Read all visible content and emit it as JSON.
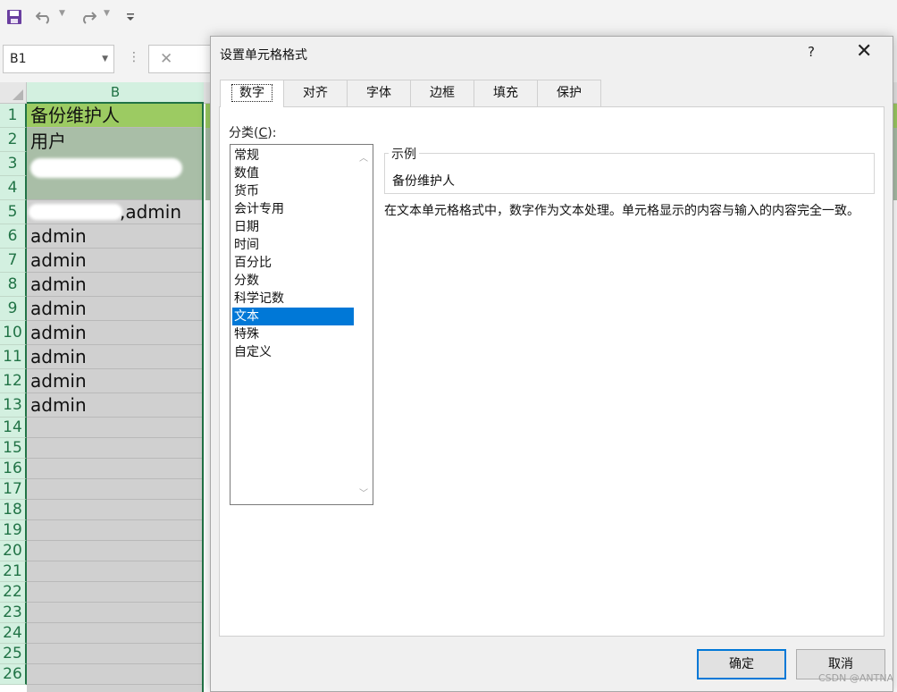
{
  "quick_access": {
    "save_icon": "floppy-save-icon",
    "undo_icon": "undo-arrow-icon",
    "redo_icon": "redo-arrow-icon",
    "customize_icon": "customize-toolbar-icon"
  },
  "formula_bar": {
    "name_box": "B1",
    "cancel_symbol": "✕"
  },
  "sheet": {
    "column_header": "B",
    "row_numbers": [
      "1",
      "2",
      "3",
      "4",
      "5",
      "6",
      "7",
      "8",
      "9",
      "10",
      "11",
      "12",
      "13",
      "14",
      "15",
      "16",
      "17",
      "18",
      "19",
      "20",
      "21",
      "22",
      "23",
      "24",
      "25",
      "26"
    ],
    "cells": {
      "b1": "备份维护人",
      "b2": "用户",
      "b3": "",
      "b5": ",admin",
      "b6": "admin",
      "b7": "admin",
      "b8": "admin",
      "b9": "admin",
      "b10": "admin",
      "b11": "admin",
      "b12": "admin",
      "b13": "admin"
    },
    "colors": {
      "header_green": "#9ccb62",
      "merged_green": "#a9bea7",
      "selection_green": "#217346"
    }
  },
  "dialog": {
    "title": "设置单元格格式",
    "help": "?",
    "close": "✕",
    "tabs": [
      "数字",
      "对齐",
      "字体",
      "边框",
      "填充",
      "保护"
    ],
    "active_tab": "数字",
    "category_label_prefix": "分类(",
    "category_label_key": "C",
    "category_label_suffix": "):",
    "categories": [
      "常规",
      "数值",
      "货币",
      "会计专用",
      "日期",
      "时间",
      "百分比",
      "分数",
      "科学记数",
      "文本",
      "特殊",
      "自定义"
    ],
    "selected_category": "文本",
    "sample_legend": "示例",
    "sample_value": "备份维护人",
    "description": "在文本单元格格式中，数字作为文本处理。单元格显示的内容与输入的内容完全一致。",
    "ok_label": "确定",
    "cancel_label": "取消",
    "accent": "#0078d7"
  },
  "watermark": "CSDN @ANTNA"
}
